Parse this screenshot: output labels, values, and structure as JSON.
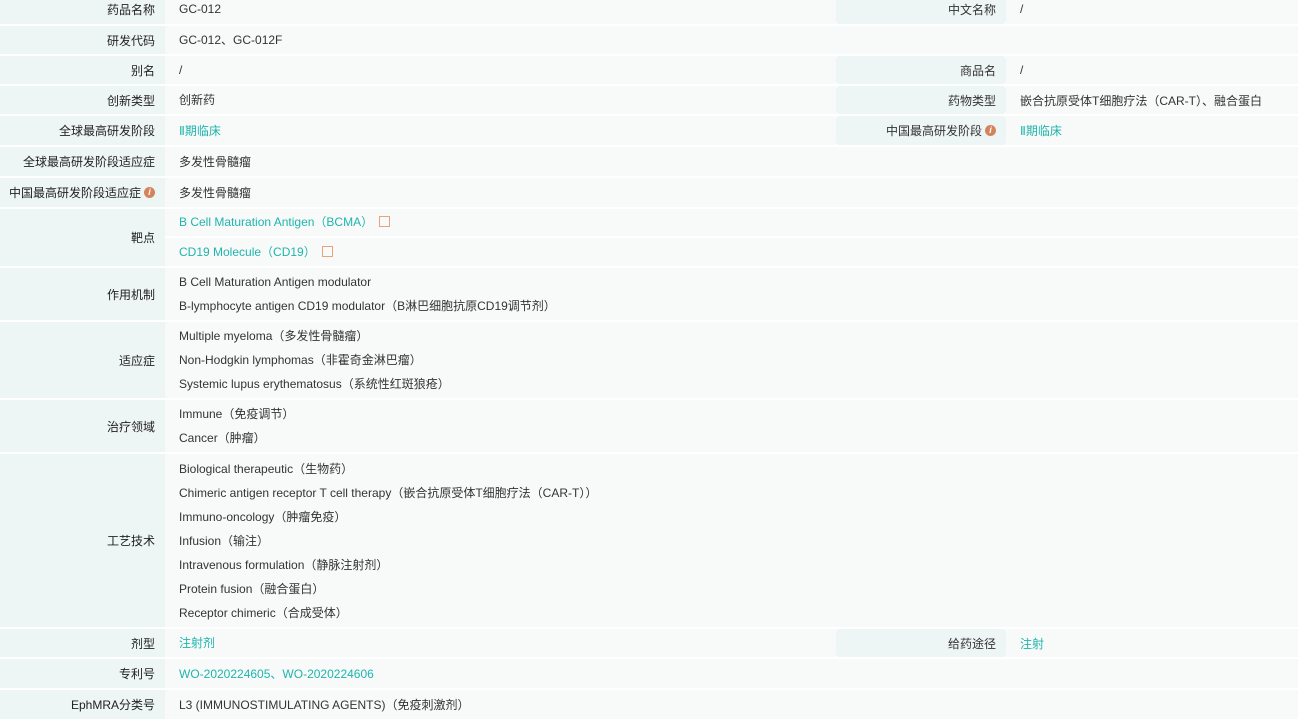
{
  "rows": {
    "name": {
      "label": "药品名称",
      "value": "GC-012",
      "right_label": "中文名称",
      "right_value": "/"
    },
    "code": {
      "label": "研发代码",
      "value": "GC-012、GC-012F"
    },
    "alias": {
      "label": "别名",
      "value": "/",
      "right_label": "商品名",
      "right_value": "/"
    },
    "innov": {
      "label": "创新类型",
      "value": "创新药",
      "right_label": "药物类型",
      "right_value": "嵌合抗原受体T细胞疗法（CAR-T）、融合蛋白"
    },
    "phase": {
      "label": "全球最高研发阶段",
      "value": "Ⅱ期临床",
      "right_label": "中国最高研发阶段",
      "right_value": "Ⅱ期临床"
    },
    "gind": {
      "label": "全球最高研发阶段适应症",
      "value": "多发性骨髓瘤"
    },
    "cind": {
      "label": "中国最高研发阶段适应症",
      "value": "多发性骨髓瘤"
    },
    "target": {
      "label": "靶点",
      "values": [
        "B Cell Maturation Antigen（BCMA）",
        "CD19 Molecule（CD19）"
      ]
    },
    "moa": {
      "label": "作用机制",
      "values": [
        "B Cell Maturation Antigen modulator",
        "B-lymphocyte antigen CD19 modulator（B淋巴细胞抗原CD19调节剂）"
      ]
    },
    "indication": {
      "label": "适应症",
      "values": [
        "Multiple myeloma（多发性骨髓瘤）",
        "Non-Hodgkin lymphomas（非霍奇金淋巴瘤）",
        "Systemic lupus erythematosus（系统性红斑狼疮）"
      ]
    },
    "area": {
      "label": "治疗领域",
      "values": [
        "Immune（免疫调节）",
        "Cancer（肿瘤）"
      ]
    },
    "tech": {
      "label": "工艺技术",
      "values": [
        "Biological therapeutic（生物药）",
        "Chimeric antigen receptor T cell therapy（嵌合抗原受体T细胞疗法（CAR-T））",
        "Immuno-oncology（肿瘤免疫）",
        "Infusion（输注）",
        "Intravenous formulation（静脉注射剂）",
        "Protein fusion（融合蛋白）",
        "Receptor chimeric（合成受体）"
      ]
    },
    "form": {
      "label": "剂型",
      "value": "注射剂",
      "right_label": "给药途径",
      "right_value": "注射"
    },
    "patent": {
      "label": "专利号",
      "values": [
        "WO-2020224605",
        "WO-2020224606"
      ],
      "sep": "、"
    },
    "ephmra": {
      "label": "EphMRA分类号",
      "value": "L3 (IMMUNOSTIMULATING AGENTS)（免疫刺激剂）"
    }
  },
  "info_glyph": "i"
}
